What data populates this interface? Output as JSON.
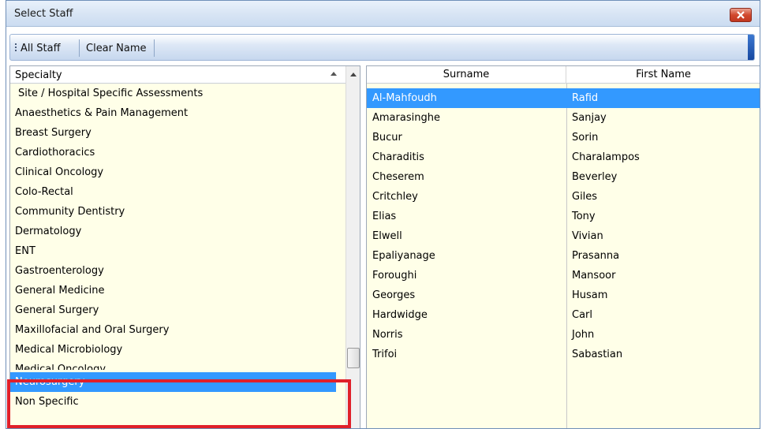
{
  "window": {
    "title": "Select Staff",
    "close_icon": "close-icon",
    "accent": "#3399ff",
    "list_background": "#ffffe8",
    "highlight_color": "#e0202a"
  },
  "toolbar": {
    "all_staff_label": "All Staff",
    "clear_name_label": "Clear Name"
  },
  "specialty": {
    "header": "Specialty",
    "sort_icon": "sort-ascending-icon",
    "items": [
      "Site / Hospital Specific Assessments",
      "Anaesthetics & Pain Management",
      "Breast Surgery",
      "Cardiothoracics",
      "Clinical Oncology",
      "Colo-Rectal",
      "Community Dentistry",
      "Dermatology",
      "ENT",
      "Gastroenterology",
      "General Medicine",
      "General Surgery",
      "Maxillofacial and Oral Surgery",
      "Medical Microbiology",
      "Medical Oncology",
      "Neurosurgery",
      "Non Specific"
    ],
    "selected": "Neurosurgery"
  },
  "staff": {
    "columns": [
      "Surname",
      "First Name"
    ],
    "rows": [
      [
        "Al-Mahfoudh",
        "Rafid"
      ],
      [
        "Amarasinghe",
        "Sanjay"
      ],
      [
        "Bucur",
        "Sorin"
      ],
      [
        "Charaditis",
        "Charalampos"
      ],
      [
        "Cheserem",
        "Beverley"
      ],
      [
        "Critchley",
        "Giles"
      ],
      [
        "Elias",
        "Tony"
      ],
      [
        "Elwell",
        "Vivian"
      ],
      [
        "Epaliyanage",
        "Prasanna"
      ],
      [
        "Foroughi",
        "Mansoor"
      ],
      [
        "Georges",
        "Husam"
      ],
      [
        "Hardwidge",
        "Carl"
      ],
      [
        "Norris",
        "John"
      ],
      [
        "Trifoi",
        "Sabastian"
      ]
    ],
    "selected_row": 0
  }
}
